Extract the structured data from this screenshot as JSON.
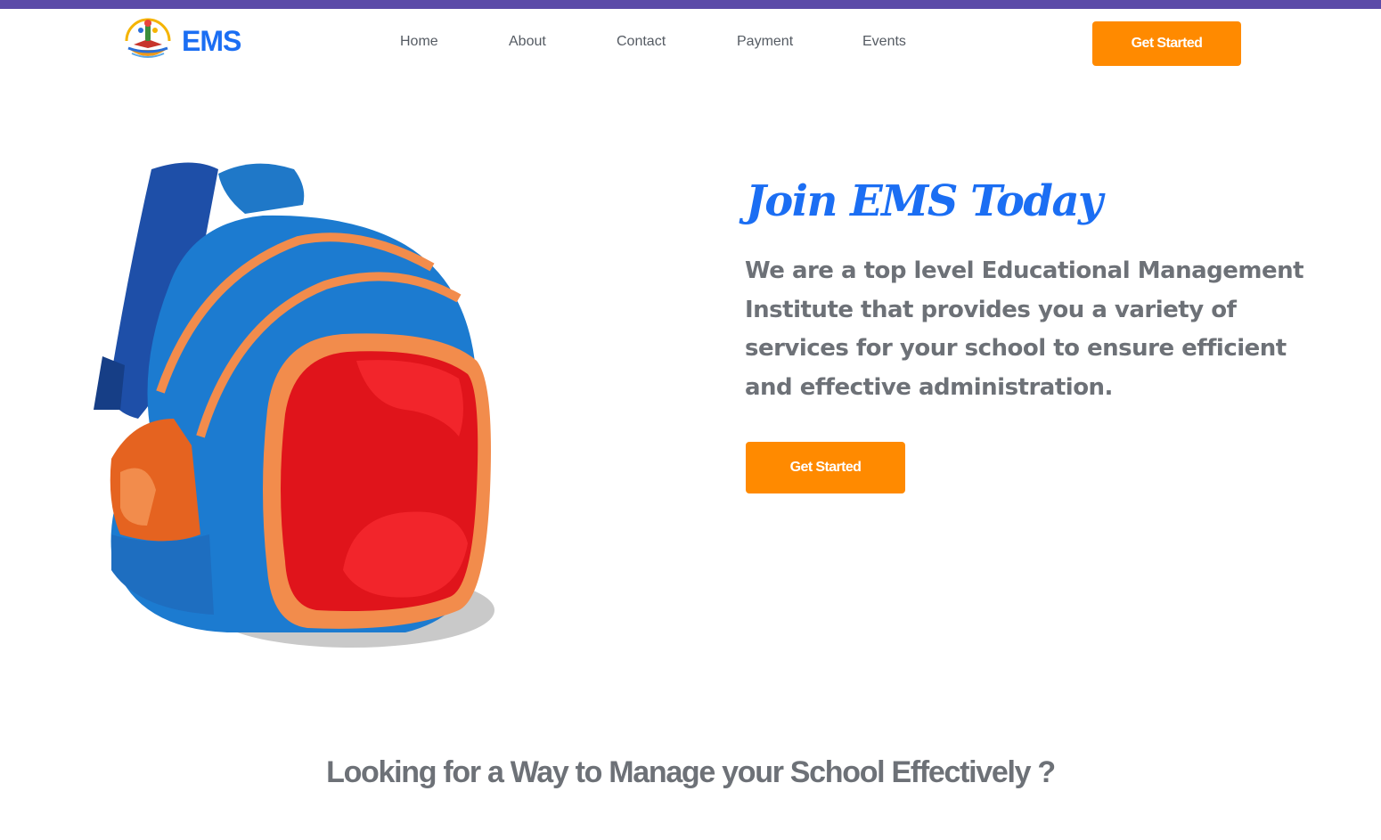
{
  "brand": {
    "name": "EMS",
    "accent": "#1b6ef3"
  },
  "nav": {
    "items": [
      "Home",
      "About",
      "Contact",
      "Payment",
      "Events"
    ],
    "cta_label": "Get Started"
  },
  "hero": {
    "title": "Join EMS Today",
    "description": "We are a top level Educational Management Institute that provides you a variety of services for your school to ensure efficient and effective administration.",
    "cta_label": "Get Started",
    "image_icon": "backpack-illustration"
  },
  "section": {
    "title": "Looking for a Way to Manage your School Effectively ?"
  },
  "colors": {
    "top_stripe": "#5b4aa8",
    "button": "#ff8a00",
    "text_muted": "#6d7177"
  }
}
